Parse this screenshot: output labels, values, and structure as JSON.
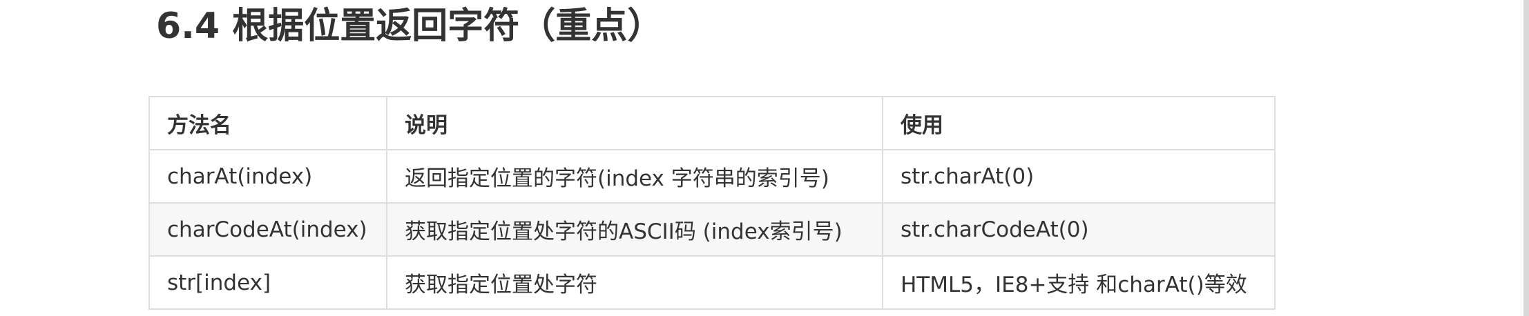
{
  "title": "6.4 根据位置返回字符（重点）",
  "table": {
    "headers": [
      "方法名",
      "说明",
      "使用"
    ],
    "rows": [
      [
        "charAt(index)",
        "返回指定位置的字符(index 字符串的索引号)",
        "str.charAt(0)"
      ],
      [
        "charCodeAt(index)",
        "获取指定位置处字符的ASCII码 (index索引号)",
        "str.charCodeAt(0)"
      ],
      [
        "str[index]",
        "获取指定位置处字符",
        "HTML5，IE8+支持 和charAt()等效"
      ]
    ]
  }
}
